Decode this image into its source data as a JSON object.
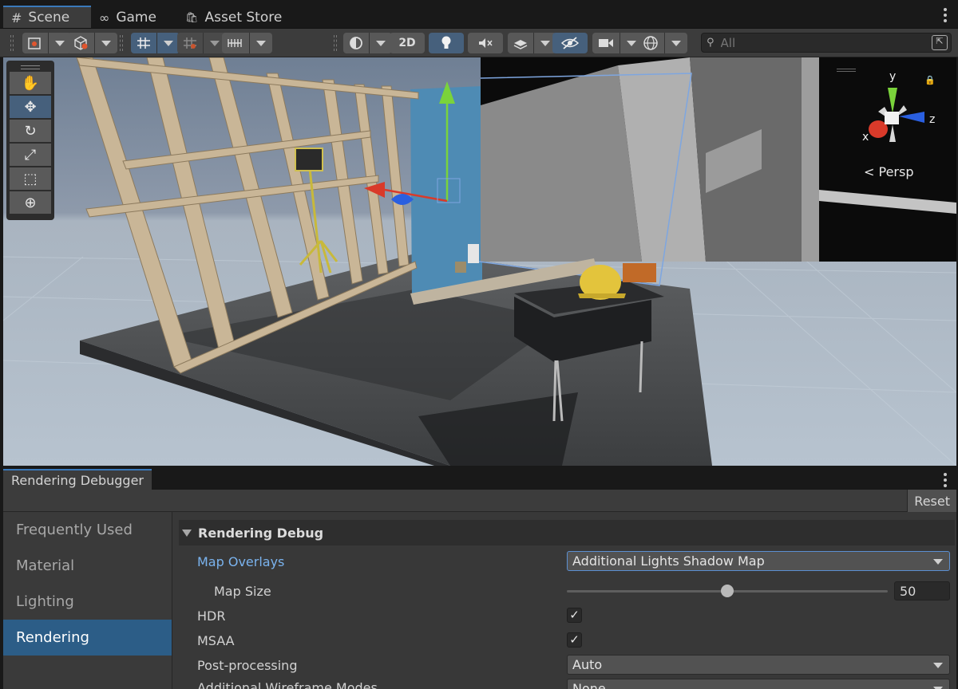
{
  "scene_tabs": [
    {
      "icon": "#",
      "label": "Scene"
    },
    {
      "icon": "∞",
      "label": "Game"
    },
    {
      "icon": "🛍",
      "label": "Asset Store"
    }
  ],
  "toolbar": {
    "mode_2d_label": "2D",
    "search_placeholder": "All"
  },
  "tools": [
    "hand-tool",
    "move-tool",
    "rotate-tool",
    "scale-tool",
    "rect-tool",
    "transform-tool"
  ],
  "viewport": {
    "projection_label": "Persp",
    "axes": {
      "x": "x",
      "y": "y",
      "z": "z"
    },
    "colors": {
      "x_axis": "#d93a2a",
      "y_axis": "#7ad33b",
      "z_axis": "#2a5fe0"
    }
  },
  "debugger": {
    "tab_label": "Rendering Debugger",
    "reset_label": "Reset",
    "sidebar": [
      {
        "label": "Frequently Used",
        "selected": false
      },
      {
        "label": "Material",
        "selected": false
      },
      {
        "label": "Lighting",
        "selected": false
      },
      {
        "label": "Rendering",
        "selected": true
      }
    ],
    "section_title": "Rendering Debug",
    "map_overlays": {
      "label": "Map Overlays",
      "value": "Additional Lights Shadow Map"
    },
    "map_size": {
      "label": "Map Size",
      "value": "50",
      "fraction": 0.5
    },
    "hdr": {
      "label": "HDR",
      "checked": true,
      "mark": "✓"
    },
    "msaa": {
      "label": "MSAA",
      "checked": true,
      "mark": "✓"
    },
    "post_processing": {
      "label": "Post-processing",
      "value": "Auto"
    },
    "wireframe": {
      "label": "Additional Wireframe Modes",
      "value": "None"
    }
  }
}
